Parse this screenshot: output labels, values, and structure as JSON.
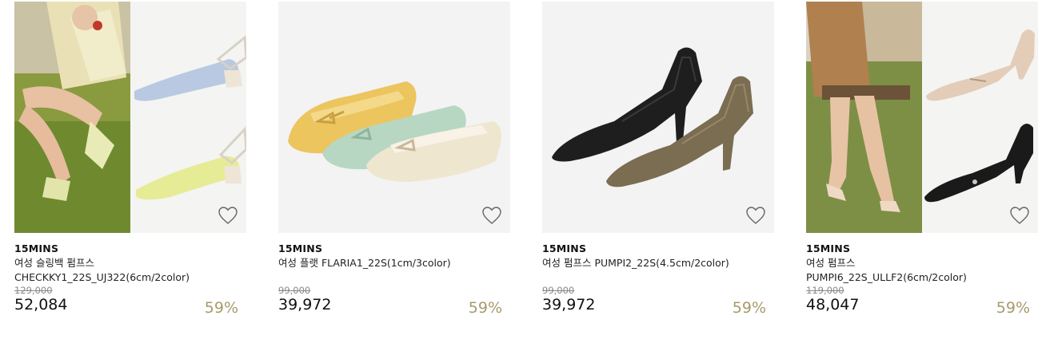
{
  "products": [
    {
      "brand": "15MINS",
      "name": "여성 슬링백 펌프스\nCHECKKY1_22S_UJ322(6cm/2color)",
      "original_price": "129,000",
      "sale_price": "52,084",
      "discount": "59%",
      "image": "slingback-gingham-pumps-photo",
      "wish_icon": "heart-outline-icon"
    },
    {
      "brand": "15MINS",
      "name": "여성 플랫 FLARIA1_22S(1cm/3color)",
      "original_price": "99,000",
      "sale_price": "39,972",
      "discount": "59%",
      "image": "ballet-flats-three-colors-photo",
      "wish_icon": "heart-outline-icon"
    },
    {
      "brand": "15MINS",
      "name": "여성 펌프스 PUMPI2_22S(4.5cm/2color)",
      "original_price": "99,000",
      "sale_price": "39,972",
      "discount": "59%",
      "image": "black-khaki-pumps-photo",
      "wish_icon": "heart-outline-icon"
    },
    {
      "brand": "15MINS",
      "name": "여성 펌프스\nPUMPI6_22S_ULLF2(6cm/2color)",
      "original_price": "119,000",
      "sale_price": "48,047",
      "discount": "59%",
      "image": "beige-black-pumps-photo",
      "wish_icon": "heart-outline-icon"
    }
  ],
  "colors": {
    "discount": "#a89a6a",
    "thumb_bg": "#f3f3f3",
    "strike": "#888888"
  }
}
